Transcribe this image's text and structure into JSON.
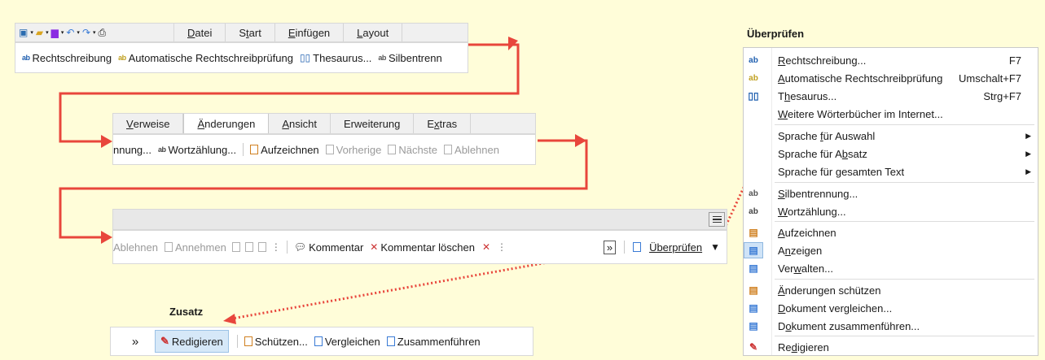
{
  "toolbar1": {
    "tabs": [
      {
        "pre": "",
        "u": "D",
        "post": "atei"
      },
      {
        "pre": "S",
        "u": "t",
        "post": "art"
      },
      {
        "pre": "",
        "u": "E",
        "post": "infügen"
      },
      {
        "pre": "",
        "u": "L",
        "post": "ayout"
      }
    ],
    "items": [
      {
        "label": "Rechtschreibung",
        "icon": "spellcheck-icon"
      },
      {
        "label": "Automatische Rechtschreibprüfung",
        "icon": "auto-spellcheck-icon"
      },
      {
        "label": "Thesaurus...",
        "icon": "thesaurus-book-icon"
      },
      {
        "label": "Silbentrenn",
        "icon": "hyphenation-icon"
      }
    ]
  },
  "toolbar2": {
    "tabs": [
      {
        "pre": "",
        "u": "V",
        "post": "erweise"
      },
      {
        "pre": "",
        "u": "Ä",
        "post": "nderungen",
        "active": true
      },
      {
        "pre": "",
        "u": "A",
        "post": "nsicht"
      },
      {
        "pre": "Erweiterung",
        "u": "",
        "post": ""
      },
      {
        "pre": "E",
        "u": "x",
        "post": "tras"
      }
    ],
    "items": [
      {
        "label": "nnung...",
        "icon": "hyphenation-icon",
        "disabled": false
      },
      {
        "label": "Wortzählung...",
        "icon": "word-count-icon",
        "disabled": false
      },
      {
        "label": "Aufzeichnen",
        "icon": "record-changes-icon",
        "disabled": false
      },
      {
        "label": "Vorherige",
        "icon": "previous-change-icon",
        "disabled": true
      },
      {
        "label": "Nächste",
        "icon": "next-change-icon",
        "disabled": true
      },
      {
        "label": "Ablehnen",
        "icon": "reject-icon",
        "disabled": true
      }
    ]
  },
  "toolbar3": {
    "items": [
      {
        "label": "Ablehnen",
        "disabled": true
      },
      {
        "label": "Annehmen",
        "disabled": true
      },
      {
        "label": "Kommentar",
        "disabled": false
      },
      {
        "label": "Kommentar löschen",
        "disabled": false
      }
    ],
    "overflow_label": "»",
    "review_label": "Überprüfen"
  },
  "zusatz": {
    "title": "Zusatz",
    "more": "»",
    "items": [
      {
        "label": "Redigieren",
        "active": true
      },
      {
        "label": "Schützen..."
      },
      {
        "label": "Vergleichen"
      },
      {
        "label": "Zusammenführen"
      }
    ]
  },
  "menu": {
    "title": "Überprüfen",
    "items": [
      {
        "pre": "",
        "u": "R",
        "post": "echtschreibung...",
        "shortcut": "F7",
        "icon": "spellcheck-icon"
      },
      {
        "pre": "",
        "u": "A",
        "post": "utomatische Rechtschreibprüfung",
        "shortcut": "Umschalt+F7",
        "icon": "auto-spellcheck-icon"
      },
      {
        "pre": "T",
        "u": "h",
        "post": "esaurus...",
        "shortcut": "Strg+F7",
        "icon": "thesaurus-book-icon"
      },
      {
        "pre": "",
        "u": "W",
        "post": "eitere Wörterbücher im Internet...",
        "shortcut": "",
        "icon": ""
      },
      {
        "pre": "Sprache ",
        "u": "f",
        "post": "ür Auswahl",
        "sub": true,
        "icon": ""
      },
      {
        "pre": "Sprache für A",
        "u": "b",
        "post": "satz",
        "sub": true,
        "icon": ""
      },
      {
        "pre": "Sprache für ",
        "u": "g",
        "post": "esamten Text",
        "sub": true,
        "icon": ""
      },
      {
        "pre": "",
        "u": "S",
        "post": "ilbentrennung...",
        "icon": "hyphenation-icon"
      },
      {
        "pre": "",
        "u": "W",
        "post": "ortzählung...",
        "icon": "word-count-icon"
      },
      {
        "pre": "",
        "u": "A",
        "post": "ufzeichnen",
        "icon": "record-changes-icon"
      },
      {
        "pre": "A",
        "u": "n",
        "post": "zeigen",
        "icon": "show-changes-icon",
        "selected": true
      },
      {
        "pre": "Ver",
        "u": "w",
        "post": "alten...",
        "icon": "manage-changes-icon"
      },
      {
        "pre": "",
        "u": "Ä",
        "post": "nderungen schützen",
        "icon": "protect-changes-icon"
      },
      {
        "pre": "",
        "u": "D",
        "post": "okument vergleichen...",
        "icon": "compare-document-icon"
      },
      {
        "pre": "D",
        "u": "o",
        "post": "kument zusammenführen...",
        "icon": "merge-document-icon"
      },
      {
        "pre": "Re",
        "u": "d",
        "post": "igieren",
        "icon": "redact-icon"
      }
    ]
  }
}
